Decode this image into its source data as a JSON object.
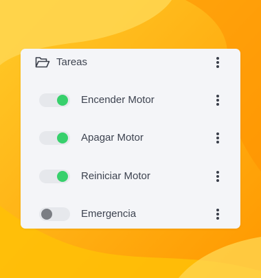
{
  "colors": {
    "background": "#ffb300",
    "card": "#f4f5f8",
    "toggle_on": "#37d06c",
    "toggle_off": "#7a7d83",
    "text": "#3d4350"
  },
  "panel": {
    "title": "Tareas",
    "icon": "folder-open-icon",
    "menu_icon": "more-vertical-icon"
  },
  "tasks": [
    {
      "label": "Encender Motor",
      "enabled": true
    },
    {
      "label": "Apagar Motor",
      "enabled": true
    },
    {
      "label": "Reiniciar Motor",
      "enabled": true
    },
    {
      "label": "Emergencia",
      "enabled": false
    }
  ]
}
